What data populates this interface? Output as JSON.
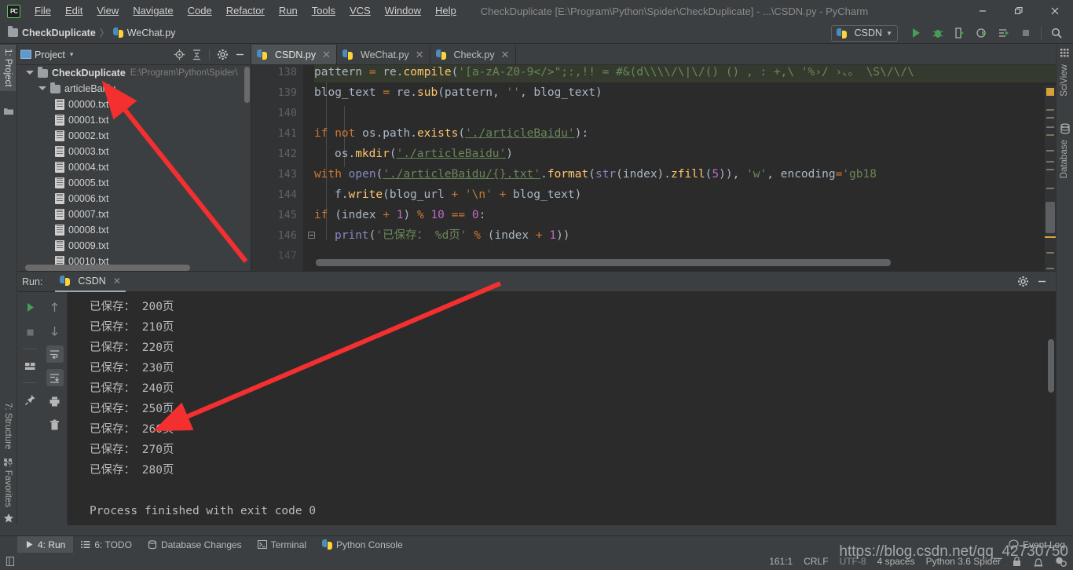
{
  "window": {
    "title": "CheckDuplicate [E:\\Program\\Python\\Spider\\CheckDuplicate] - ...\\CSDN.py - PyCharm",
    "logo": "PC",
    "minimize": "—",
    "restore": "❐",
    "close": "✕"
  },
  "menu": [
    {
      "label": "File"
    },
    {
      "label": "Edit"
    },
    {
      "label": "View"
    },
    {
      "label": "Navigate"
    },
    {
      "label": "Code"
    },
    {
      "label": "Refactor"
    },
    {
      "label": "Run"
    },
    {
      "label": "Tools"
    },
    {
      "label": "VCS"
    },
    {
      "label": "Window"
    },
    {
      "label": "Help"
    }
  ],
  "breadcrumb": {
    "project": "CheckDuplicate",
    "separator": "〉",
    "file": "WeChat.py"
  },
  "toolbar": {
    "run_config": "CSDN",
    "dropdown_caret": "▼",
    "icons": [
      "run-icon",
      "debug-icon",
      "coverage-icon",
      "profile-icon",
      "attach-icon",
      "stop-icon",
      "search-icon"
    ]
  },
  "left_stripe": {
    "project_tab": "1: Project",
    "structure_tab": "7: Structure",
    "favorites_tab": "2: Favorites"
  },
  "right_stripe": {
    "sciview_tab": "SciView",
    "database_tab": "Database"
  },
  "project_panel": {
    "title": "Project",
    "caret": "▾",
    "header_icons": [
      "locate-icon",
      "collapse-all-icon",
      "gear-icon",
      "minimize-icon"
    ],
    "tree": [
      {
        "name": "CheckDuplicate",
        "path": "E:\\Program\\Python\\Spider\\",
        "type": "root",
        "indent": 0,
        "expanded": true
      },
      {
        "name": "articleBaidu",
        "path": "",
        "type": "folder",
        "indent": 1,
        "expanded": true
      },
      {
        "name": "00000.txt",
        "path": "",
        "type": "file",
        "indent": 2
      },
      {
        "name": "00001.txt",
        "path": "",
        "type": "file",
        "indent": 2
      },
      {
        "name": "00002.txt",
        "path": "",
        "type": "file",
        "indent": 2
      },
      {
        "name": "00003.txt",
        "path": "",
        "type": "file",
        "indent": 2
      },
      {
        "name": "00004.txt",
        "path": "",
        "type": "file",
        "indent": 2
      },
      {
        "name": "00005.txt",
        "path": "",
        "type": "file",
        "indent": 2
      },
      {
        "name": "00006.txt",
        "path": "",
        "type": "file",
        "indent": 2
      },
      {
        "name": "00007.txt",
        "path": "",
        "type": "file",
        "indent": 2
      },
      {
        "name": "00008.txt",
        "path": "",
        "type": "file",
        "indent": 2
      },
      {
        "name": "00009.txt",
        "path": "",
        "type": "file",
        "indent": 2
      },
      {
        "name": "00010.txt",
        "path": "",
        "type": "file",
        "indent": 2
      }
    ]
  },
  "editor": {
    "tabs": [
      {
        "label": "CSDN.py",
        "active": true,
        "close": "✕"
      },
      {
        "label": "WeChat.py",
        "active": false,
        "close": "✕"
      },
      {
        "label": "Check.py",
        "active": false,
        "close": "✕"
      }
    ],
    "line_numbers": [
      "138",
      "139",
      "140",
      "141",
      "142",
      "143",
      "144",
      "145",
      "146",
      "147"
    ],
    "code": [
      "        pattern = re.compile('[a-zA-Z0-9</>\";:,!! = #&(d\\\\\\\\/\\\\|\\\\/() () , : +,\\\\ '%›/ ›、。 \\\\S\\\\/\\\\/\\\\",
      "        blog_text = re.sub(pattern, '', blog_text)",
      "",
      "        if not os.path.exists('./articleBaidu'):",
      "            os.mkdir('./articleBaidu')",
      "        with open('./articleBaidu/{}.txt'.format(str(index).zfill(5)), 'w', encoding='gb18",
      "            f.write(blog_url + '\\n' + blog_text)",
      "        if (index + 1) % 10 == 0:",
      "            print('已保存： %d页' % (index + 1))",
      ""
    ]
  },
  "run_panel": {
    "label": "Run:",
    "tab": "CSDN",
    "tab_close": "✕",
    "gear": "gear-icon",
    "minimize": "—",
    "toolbar_left": [
      "rerun-icon",
      "stop-icon",
      "layout-icon",
      "pin-icon"
    ],
    "toolbar_right": [
      "up-icon",
      "down-icon",
      "soft-wrap-icon",
      "scroll-end-icon",
      "print-icon",
      "trash-icon"
    ],
    "console_output": [
      "已保存： 200页",
      "已保存： 210页",
      "已保存： 220页",
      "已保存： 230页",
      "已保存： 240页",
      "已保存： 250页",
      "已保存： 260页",
      "已保存： 270页",
      "已保存： 280页",
      "",
      "Process finished with exit code 0"
    ]
  },
  "bottom_bar": {
    "items": [
      {
        "label": "4: Run",
        "icon": "run-icon",
        "active": true
      },
      {
        "label": "6: TODO",
        "icon": "todo-icon",
        "active": false
      },
      {
        "label": "Database Changes",
        "icon": "database-icon",
        "active": false
      },
      {
        "label": "Terminal",
        "icon": "terminal-icon",
        "active": false
      },
      {
        "label": "Python Console",
        "icon": "python-icon",
        "active": false
      }
    ],
    "event_log": "Event Log"
  },
  "status_bar": {
    "caret_position": "161:1",
    "line_separator": "CRLF",
    "encoding": "UTF-8",
    "indent": "4 spaces",
    "interpreter": "Python 3.6 Spider",
    "icons": [
      "lock-icon",
      "inspection-icon",
      "settings-icon"
    ]
  },
  "watermark": "https://blog.csdn.net/qq_42730750",
  "colors": {
    "bg": "#3c3f41",
    "editor_bg": "#2b2b2b",
    "accent_green": "#499c54",
    "arrow_red": "#f03030",
    "keyword": "#cc7832",
    "string": "#6a8759",
    "number": "#bf6ac2",
    "function": "#ffc66d"
  }
}
